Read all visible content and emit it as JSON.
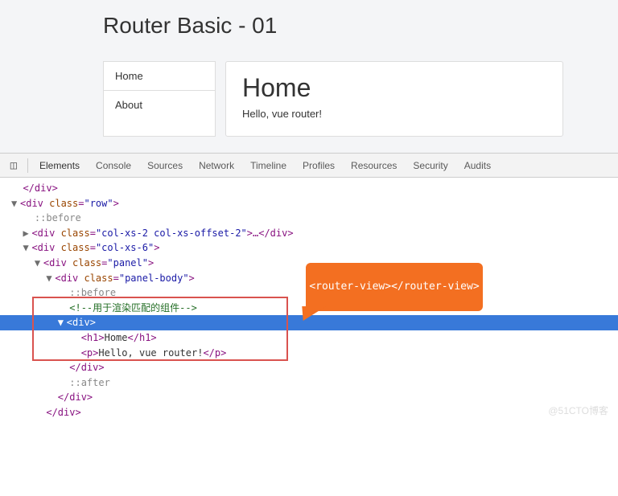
{
  "title": "Router Basic - 01",
  "nav": {
    "items": [
      "Home",
      "About"
    ]
  },
  "panel": {
    "heading": "Home",
    "text": "Hello, vue router!"
  },
  "devtools": {
    "tabs": [
      "Elements",
      "Console",
      "Sources",
      "Network",
      "Timeline",
      "Profiles",
      "Resources",
      "Security",
      "Audits"
    ],
    "tree": {
      "l0": "</div>",
      "l1_open": "<div ",
      "l1_attr": "class",
      "l1_val": "\"row\"",
      "l1_close": ">",
      "l2": "::before",
      "l3_open": "<div ",
      "l3_attr": "class",
      "l3_val": "\"col-xs-2 col-xs-offset-2\"",
      "l3_mid": ">…",
      "l3_close": "</div>",
      "l4_open": "<div ",
      "l4_attr": "class",
      "l4_val": "\"col-xs-6\"",
      "l4_close": ">",
      "l5_open": "<div ",
      "l5_attr": "class",
      "l5_val": "\"panel\"",
      "l5_close": ">",
      "l6_open": "<div ",
      "l6_attr": "class",
      "l6_val": "\"panel-body\"",
      "l6_close": ">",
      "l7": "::before",
      "l8": "<!--用于渲染匹配的组件-->",
      "l9_open": "<div",
      "l9_close": ">",
      "l10_o": "<h1>",
      "l10_t": "Home",
      "l10_c": "</h1>",
      "l11_o": "<p>",
      "l11_t": "Hello, vue router!",
      "l11_c": "</p>",
      "l12": "</div>",
      "l13": "::after",
      "l14": "</div>",
      "l15": "</div>"
    }
  },
  "callout": "<router-view></router-view>",
  "watermark": "@51CTO博客"
}
